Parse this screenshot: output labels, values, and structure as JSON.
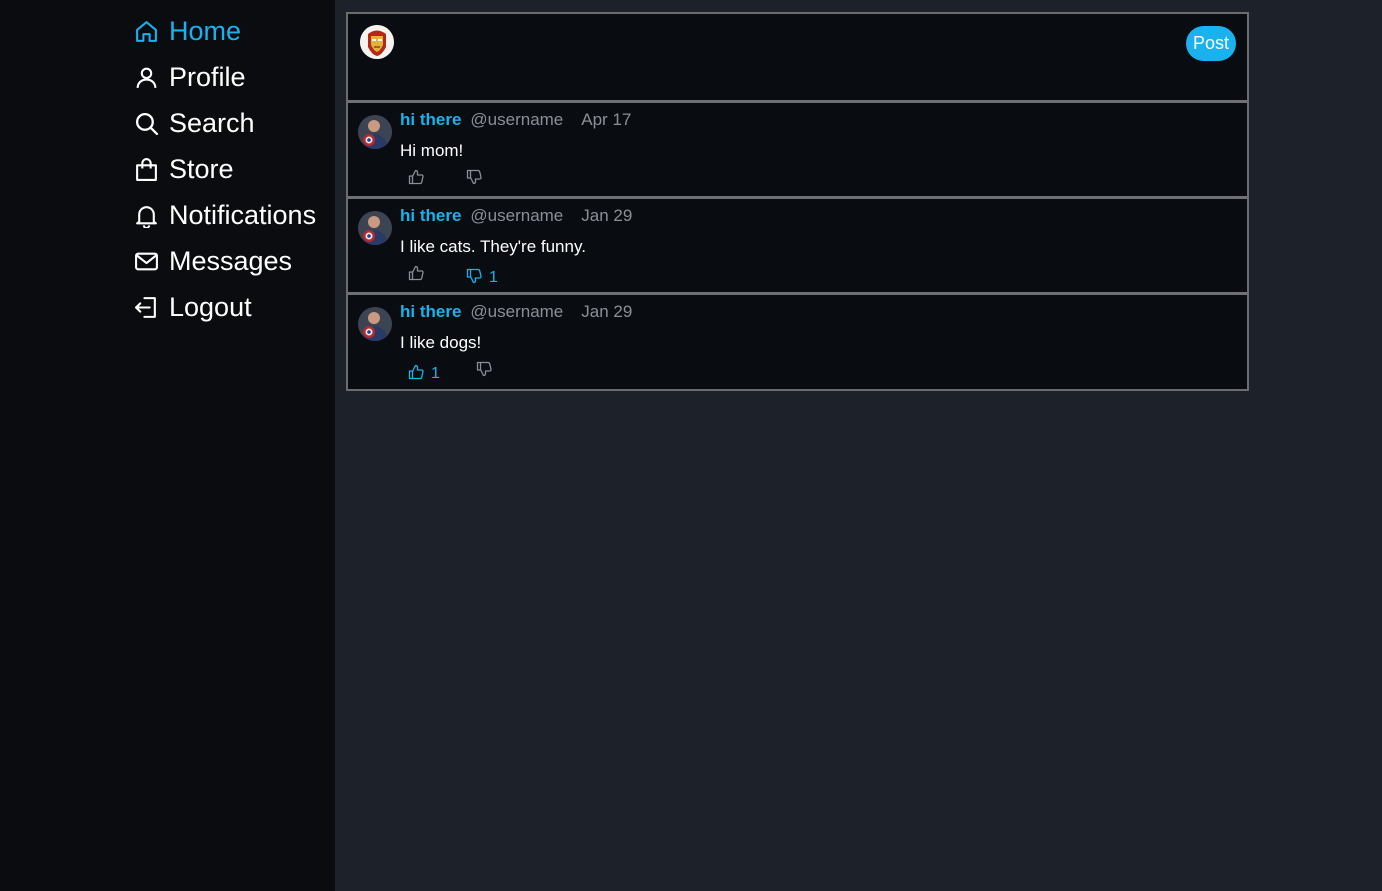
{
  "sidebar": {
    "items": [
      {
        "label": "Home",
        "icon": "home-icon"
      },
      {
        "label": "Profile",
        "icon": "user-icon"
      },
      {
        "label": "Search",
        "icon": "search-icon"
      },
      {
        "label": "Store",
        "icon": "shopping-bag-icon"
      },
      {
        "label": "Notifications",
        "icon": "bell-icon"
      },
      {
        "label": "Messages",
        "icon": "mail-icon"
      },
      {
        "label": "Logout",
        "icon": "logout-icon"
      }
    ]
  },
  "compose": {
    "post_label": "Post",
    "avatar": "iron-man-avatar"
  },
  "tweets": [
    {
      "name": "hi there",
      "handle": "@username",
      "date": "Apr 17",
      "text": "Hi mom!",
      "likes": "",
      "dislikes": ""
    },
    {
      "name": "hi there",
      "handle": "@username",
      "date": "Jan 29",
      "text": "I like cats. They're funny.",
      "likes": "",
      "dislikes": "1"
    },
    {
      "name": "hi there",
      "handle": "@username",
      "date": "Jan 29",
      "text": "I like dogs!",
      "likes": "1",
      "dislikes": ""
    }
  ],
  "colors": {
    "accent": "#1ab2ee",
    "sidebar_bg": "#0a0c0f",
    "page_bg": "#1d2129",
    "feed_bg": "#090c10",
    "muted": "#8b8f98",
    "inactive_icon": "#8a8f99"
  }
}
